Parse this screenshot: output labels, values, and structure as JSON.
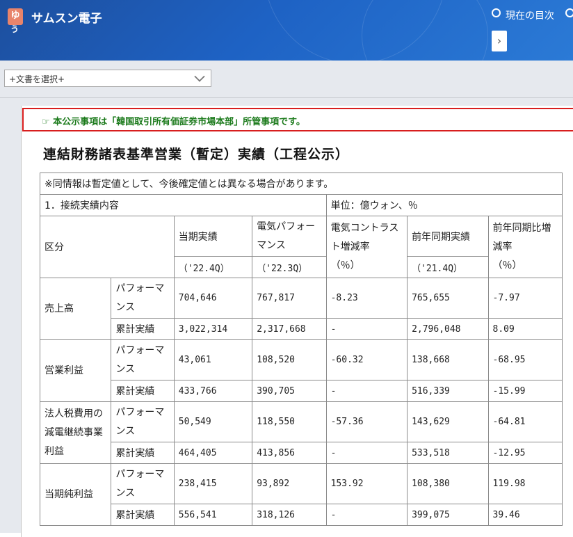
{
  "header": {
    "logo_text": "ゆ",
    "logo_sub": "う",
    "company": "サムスン電子",
    "toc_label": "現在の目次",
    "next_icon": "chevron-right-icon"
  },
  "toolbar": {
    "doc_select_value": "+文書を選択+"
  },
  "notice": {
    "text": "☞ 本公示事項は「韓国取引所有価証券市場本部」所管事項です。"
  },
  "doc_title": "連結財務諸表基準営業（暫定）実績（工程公示）",
  "table": {
    "disclaimer": "※同情報は暫定値として、今後確定値とは異なる場合があります。",
    "section_label": "1．接続実績内容",
    "unit_label": "単位：億ウォン、％",
    "headers": {
      "category": "区分",
      "current": "当期実績",
      "prev_quarter": "電気パフォーマンス",
      "qoq_rate": "電気コントラスト増減率",
      "prev_year": "前年同期実績",
      "yoy_rate": "前年同期比増減率",
      "current_period": "（'22.4Q）",
      "prev_quarter_period": "（'22.3Q）",
      "qoq_unit": "（％）",
      "prev_year_period": "（'21.4Q）",
      "yoy_unit": "（％）"
    },
    "groups": [
      {
        "name": "売上高",
        "rows": [
          {
            "sub": "パフォーマンス",
            "current": "704,646",
            "prev_quarter": "767,817",
            "qoq": "-8.23",
            "prev_year": "765,655",
            "yoy": "-7.97"
          },
          {
            "sub": "累計実績",
            "current": "3,022,314",
            "prev_quarter": "2,317,668",
            "qoq": "-",
            "prev_year": "2,796,048",
            "yoy": "8.09"
          }
        ]
      },
      {
        "name": "営業利益",
        "rows": [
          {
            "sub": "パフォーマンス",
            "current": "43,061",
            "prev_quarter": "108,520",
            "qoq": "-60.32",
            "prev_year": "138,668",
            "yoy": "-68.95"
          },
          {
            "sub": "累計実績",
            "current": "433,766",
            "prev_quarter": "390,705",
            "qoq": "-",
            "prev_year": "516,339",
            "yoy": "-15.99"
          }
        ]
      },
      {
        "name": "法人税費用の減電継続事業利益",
        "rows": [
          {
            "sub": "パフォーマンス",
            "current": "50,549",
            "prev_quarter": "118,550",
            "qoq": "-57.36",
            "prev_year": "143,629",
            "yoy": "-64.81"
          },
          {
            "sub": "累計実績",
            "current": "464,405",
            "prev_quarter": "413,856",
            "qoq": "-",
            "prev_year": "533,518",
            "yoy": "-12.95"
          }
        ]
      },
      {
        "name": "当期純利益",
        "rows": [
          {
            "sub": "パフォーマンス",
            "current": "238,415",
            "prev_quarter": "93,892",
            "qoq": "153.92",
            "prev_year": "108,380",
            "yoy": "119.98"
          },
          {
            "sub": "累計実績",
            "current": "556,541",
            "prev_quarter": "318,126",
            "qoq": "-",
            "prev_year": "399,075",
            "yoy": "39.46"
          }
        ]
      }
    ]
  }
}
